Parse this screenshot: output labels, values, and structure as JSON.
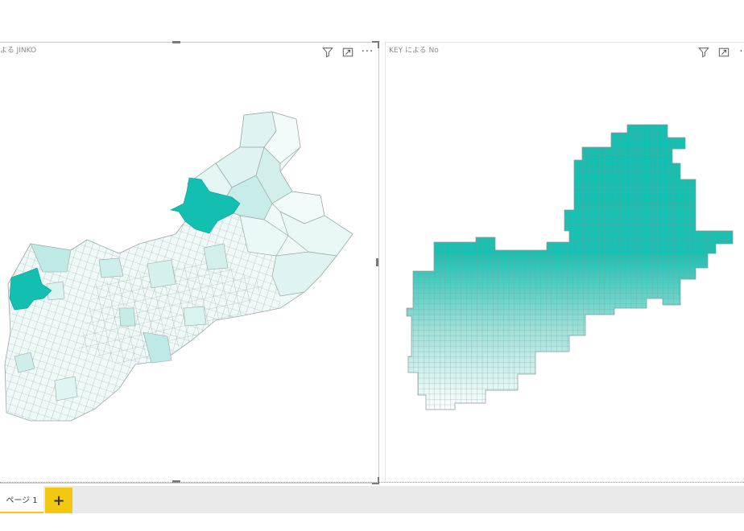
{
  "visuals": {
    "left": {
      "title": "よる JINKO",
      "icons": [
        "filter-icon",
        "focus-mode-icon",
        "more-options-icon"
      ],
      "more_label": "···"
    },
    "right": {
      "title": "KEY による No",
      "icons": [
        "filter-icon",
        "focus-mode-icon",
        "more-options-icon"
      ],
      "more_label": "··"
    }
  },
  "colors": {
    "accent_teal": "#12bfb0",
    "light_teal": "#d9f3f1",
    "boundary": "#9aa8a8",
    "tab_accent": "#f2c811"
  },
  "tabs": [
    {
      "label": "ページ 1",
      "active": true
    }
  ],
  "add_tab_label": "+"
}
